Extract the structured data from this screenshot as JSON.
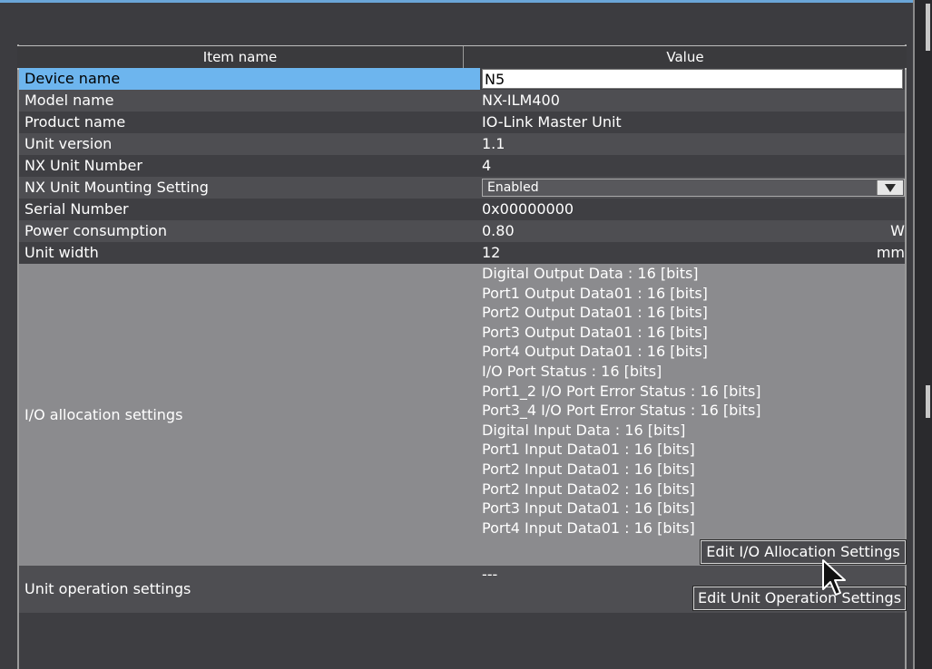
{
  "header": {
    "item_col": "Item name",
    "value_col": "Value"
  },
  "rows": [
    {
      "label": "Device name",
      "value": "N5"
    },
    {
      "label": "Model name",
      "value": "NX-ILM400"
    },
    {
      "label": "Product name",
      "value": "IO-Link Master Unit"
    },
    {
      "label": "Unit version",
      "value": "1.1"
    },
    {
      "label": "NX Unit Number",
      "value": "4"
    },
    {
      "label": "NX Unit Mounting Setting",
      "value": "Enabled"
    },
    {
      "label": "Serial Number",
      "value": "0x00000000"
    },
    {
      "label": "Power consumption",
      "value": "0.80",
      "unit": "W"
    },
    {
      "label": "Unit width",
      "value": "12",
      "unit": "mm"
    }
  ],
  "io_allocation": {
    "label": "I/O allocation settings",
    "items": [
      "Digital Output Data : 16 [bits]",
      "Port1 Output Data01 : 16 [bits]",
      "Port2 Output Data01 : 16 [bits]",
      "Port3 Output Data01 : 16 [bits]",
      "Port4 Output Data01 : 16 [bits]",
      "I/O Port Status : 16 [bits]",
      "Port1_2 I/O Port Error Status : 16 [bits]",
      "Port3_4 I/O Port Error Status : 16 [bits]",
      "Digital Input Data : 16 [bits]",
      "Port1 Input Data01 : 16 [bits]",
      "Port2 Input Data01 : 16 [bits]",
      "Port2 Input Data02 : 16 [bits]",
      "Port3 Input Data01 : 16 [bits]",
      "Port4 Input Data01 : 16 [bits]"
    ],
    "button_label": "Edit I/O Allocation Settings"
  },
  "unit_operation": {
    "label": "Unit operation settings",
    "value": "---",
    "button_label": "Edit Unit Operation Settings"
  },
  "colors": {
    "selection": "#6db5ee",
    "accent": "#6aa6d8",
    "io_block_bg": "#8b8b8e"
  }
}
